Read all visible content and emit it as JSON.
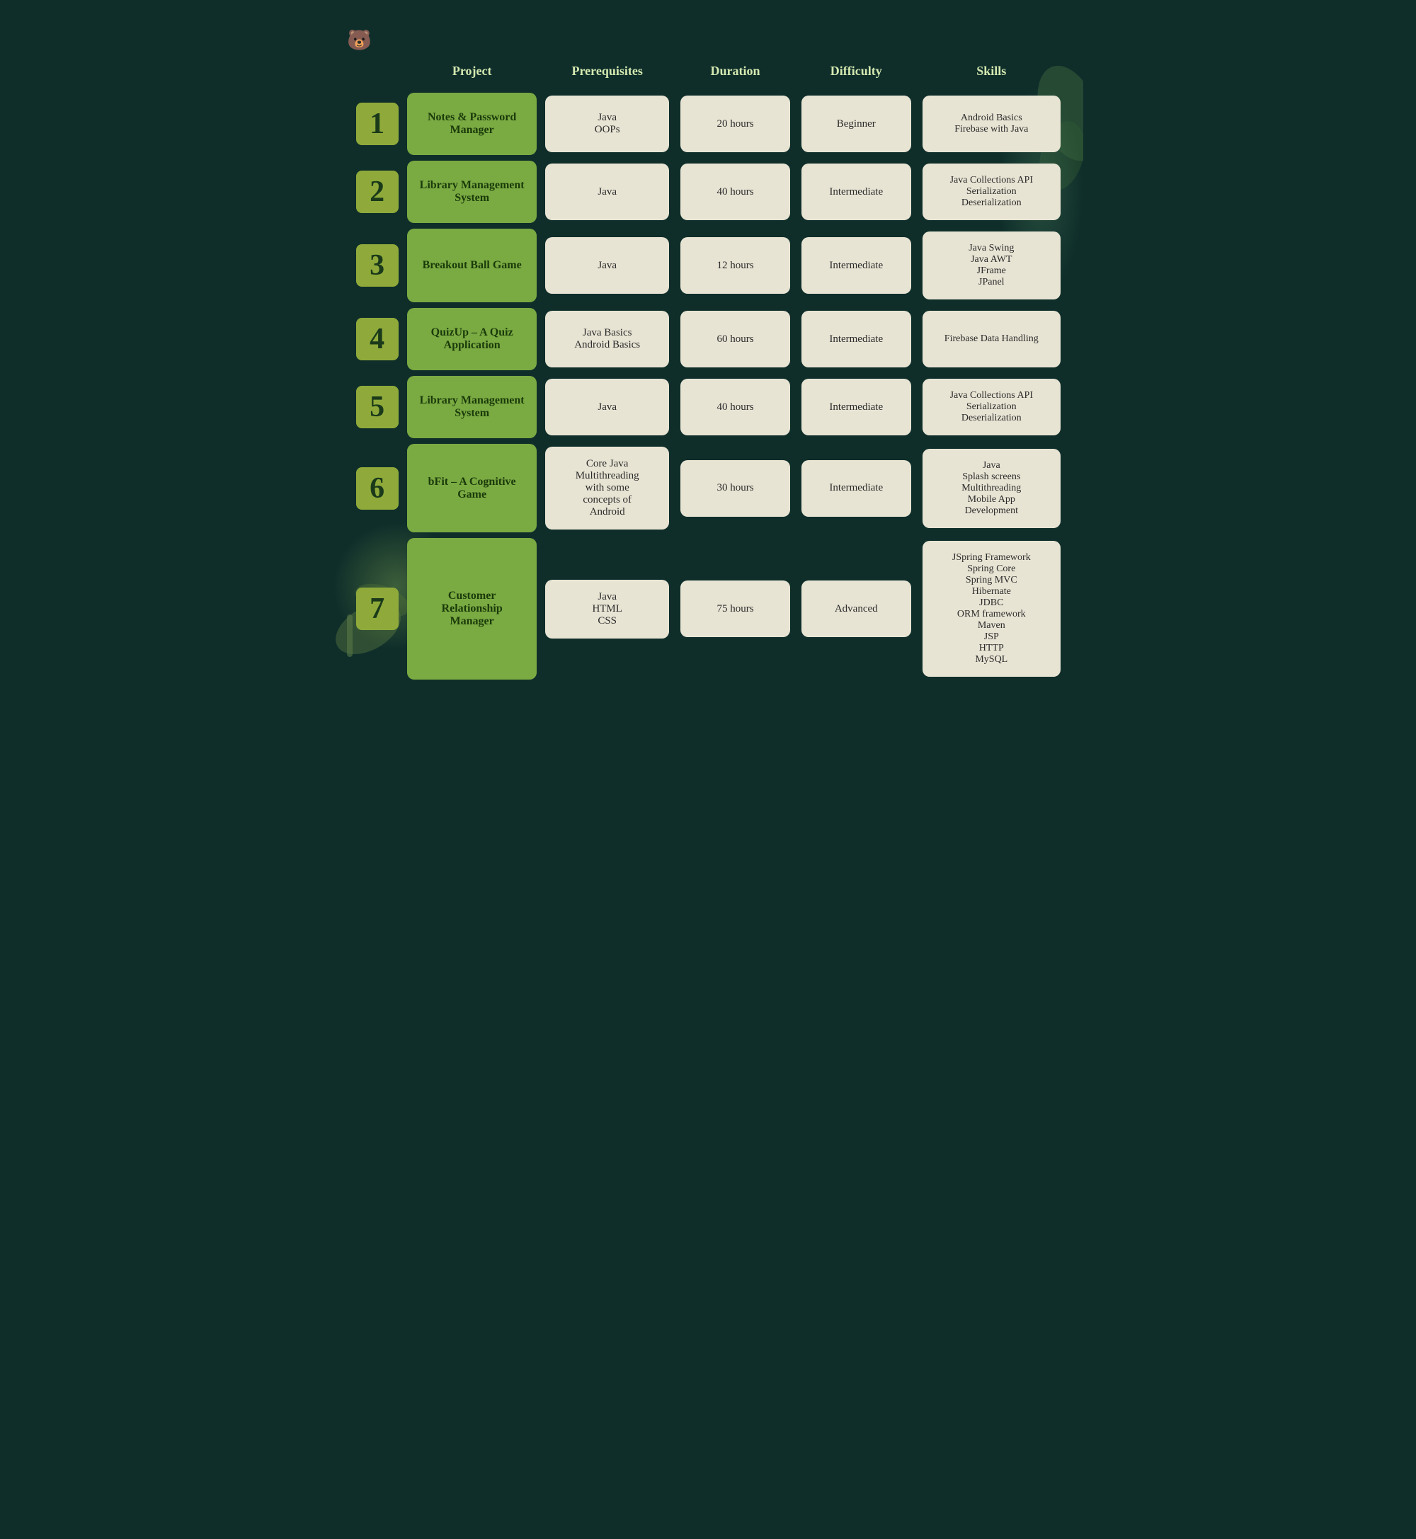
{
  "logo": "🐻",
  "headers": {
    "number": "",
    "project": "Project",
    "prerequisites": "Prerequisites",
    "duration": "Duration",
    "difficulty": "Difficulty",
    "skills": "Skills"
  },
  "rows": [
    {
      "number": "1",
      "project": "Notes & Password Manager",
      "prerequisites": "Java\nOOPs",
      "duration": "20 hours",
      "difficulty": "Beginner",
      "skills": "Android Basics\nFirebase with Java"
    },
    {
      "number": "2",
      "project": "Library Management System",
      "prerequisites": "Java",
      "duration": "40 hours",
      "difficulty": "Intermediate",
      "skills": "Java Collections API\nSerialization\nDeserialization"
    },
    {
      "number": "3",
      "project": "Breakout Ball Game",
      "prerequisites": "Java",
      "duration": "12 hours",
      "difficulty": "Intermediate",
      "skills": "Java Swing\nJava AWT\nJFrame\nJPanel"
    },
    {
      "number": "4",
      "project": "QuizUp – A Quiz Application",
      "prerequisites": "Java Basics\nAndroid Basics",
      "duration": "60 hours",
      "difficulty": "Intermediate",
      "skills": "Firebase Data Handling"
    },
    {
      "number": "5",
      "project": "Library Management System",
      "prerequisites": "Java",
      "duration": "40 hours",
      "difficulty": "Intermediate",
      "skills": "Java Collections API\nSerialization\nDeserialization"
    },
    {
      "number": "6",
      "project": "bFit – A Cognitive Game",
      "prerequisites": "Core Java\nMultithreading\nwith some\nconcepts of\nAndroid",
      "duration": "30 hours",
      "difficulty": "Intermediate",
      "skills": "Java\nSplash screens\nMultithreading\nMobile App\nDevelopment"
    },
    {
      "number": "7",
      "project": "Customer Relationship Manager",
      "prerequisites": "Java\nHTML\nCSS",
      "duration": "75 hours",
      "difficulty": "Advanced",
      "skills": "JSpring Framework\nSpring Core\nSpring MVC\nHibernate\nJDBC\nORM framework\nMaven\nJSP\nHTTP\nMySQL"
    }
  ]
}
